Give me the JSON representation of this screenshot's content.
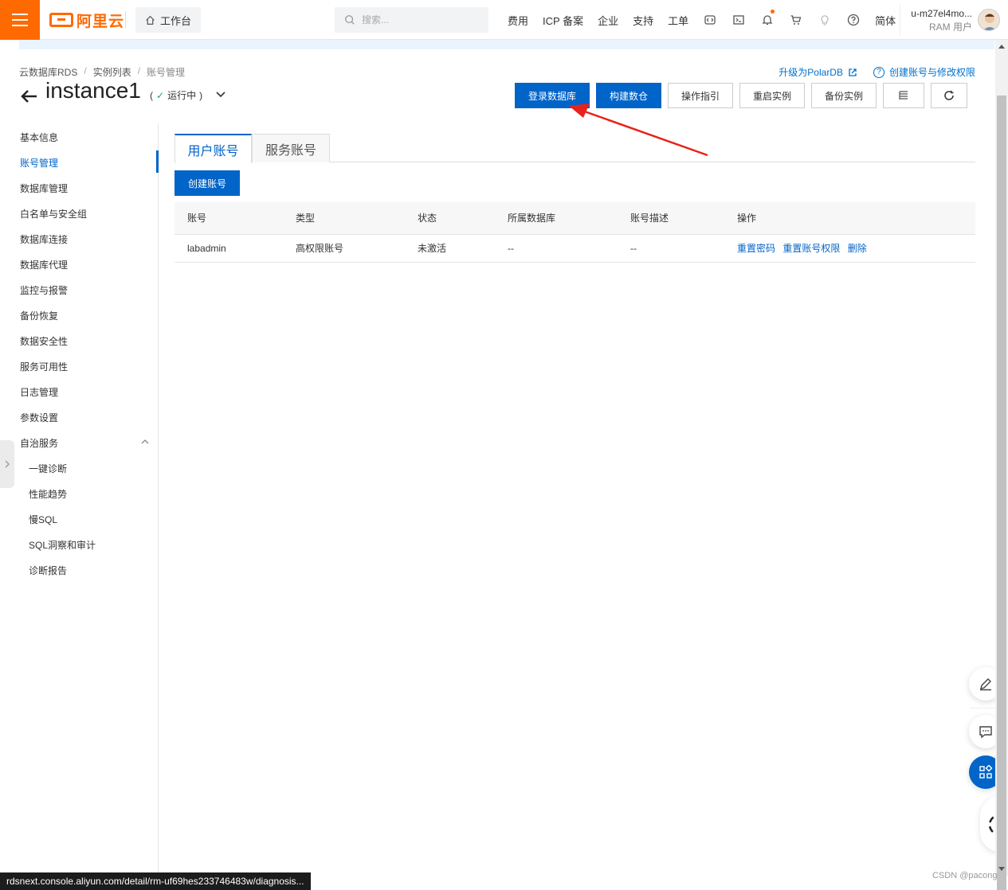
{
  "topbar": {
    "brand": "阿里云",
    "workbench_label": "工作台",
    "search_placeholder": "搜索...",
    "nav_items": [
      "费用",
      "ICP 备案",
      "企业",
      "支持",
      "工单"
    ],
    "lang_label": "简体",
    "user_name": "u-m27el4mo...",
    "user_role": "RAM 用户",
    "brand_color": "#ff6a00"
  },
  "breadcrumb": {
    "items": [
      "云数据库RDS",
      "实例列表",
      "账号管理"
    ],
    "separator": "/"
  },
  "header": {
    "title": "instance1",
    "status_open": "(",
    "status_text": "运行中",
    "status_close": ")",
    "upgrade_link": "升级为PolarDB",
    "help_link": "创建账号与修改权限",
    "help_icon_glyph": "?"
  },
  "actions": {
    "login_db": "登录数据库",
    "build_dw": "构建数仓",
    "guide": "操作指引",
    "restart": "重启实例",
    "backup": "备份实例"
  },
  "sidebar": {
    "items": [
      "基本信息",
      "账号管理",
      "数据库管理",
      "白名单与安全组",
      "数据库连接",
      "数据库代理",
      "监控与报警",
      "备份恢复",
      "数据安全性",
      "服务可用性",
      "日志管理",
      "参数设置",
      "自治服务"
    ],
    "sub_items": [
      "一键诊断",
      "性能趋势",
      "慢SQL",
      "SQL洞察和审计",
      "诊断报告"
    ],
    "active": "账号管理"
  },
  "tabs": {
    "user_accounts": "用户账号",
    "service_accounts": "服务账号"
  },
  "table": {
    "create_button": "创建账号",
    "columns": [
      "账号",
      "类型",
      "状态",
      "所属数据库",
      "账号描述",
      "操作"
    ],
    "rows": [
      {
        "account": "labadmin",
        "type": "高权限账号",
        "status": "未激活",
        "database": "--",
        "description": "--",
        "ops": [
          "重置密码",
          "重置账号权限",
          "删除"
        ]
      }
    ]
  },
  "status_bar": {
    "url": "rdsnext.console.aliyun.com/detail/rm-uf69hes233746483w/diagnosis..."
  },
  "watermark": "CSDN @pacong",
  "colors": {
    "primary": "#0064c8",
    "annotation": "#e8231b",
    "success": "#1aaa55"
  }
}
